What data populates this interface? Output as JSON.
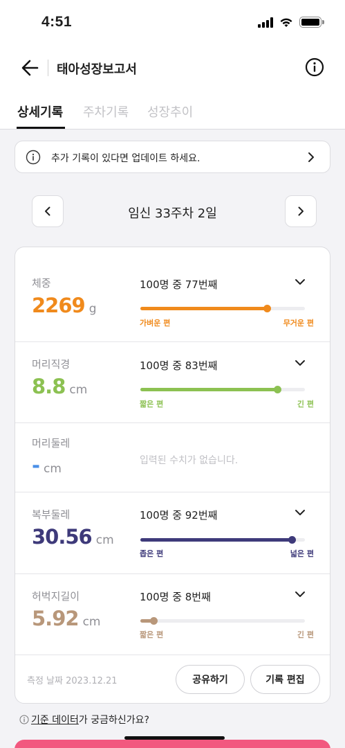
{
  "status_bar": {
    "time": "4:51"
  },
  "header": {
    "title": "태아성장보고서"
  },
  "tabs": [
    {
      "label": "상세기록",
      "active": true
    },
    {
      "label": "주차기록",
      "active": false
    },
    {
      "label": "성장추이",
      "active": false
    }
  ],
  "notice": {
    "text": "추가 기록이 있다면 업데이트 하세요."
  },
  "week_nav": {
    "label": "임신 33주차 2일"
  },
  "metrics": [
    {
      "label": "체중",
      "value": "2269",
      "unit": "g",
      "rank": "100명 중 77번째",
      "percentile": 77,
      "low_label": "가벼운 편",
      "high_label": "무거운 편",
      "color": "#f08a1c"
    },
    {
      "label": "머리직경",
      "value": "8.8",
      "unit": "cm",
      "rank": "100명 중 83번째",
      "percentile": 83,
      "low_label": "짧은 편",
      "high_label": "긴 편",
      "color": "#8cc152"
    },
    {
      "label": "머리둘레",
      "value": "-",
      "unit": "cm",
      "no_data": "입력된 수치가 없습니다.",
      "color": "#4a8fe7"
    },
    {
      "label": "복부둘레",
      "value": "30.56",
      "unit": "cm",
      "rank": "100명 중 92번째",
      "percentile": 92,
      "low_label": "좁은 편",
      "high_label": "넓은 편",
      "color": "#3e3a7a"
    },
    {
      "label": "허벅지길이",
      "value": "5.92",
      "unit": "cm",
      "rank": "100명 중 8번째",
      "percentile": 8,
      "low_label": "짧은 편",
      "high_label": "긴 편",
      "color": "#b8977a"
    }
  ],
  "footer": {
    "measure_date": "측정 날짜 2023.12.21",
    "share_label": "공유하기",
    "edit_label": "기록 편집"
  },
  "help": {
    "link_text": "기준 데이터",
    "suffix": "가 궁금하신가요?"
  }
}
